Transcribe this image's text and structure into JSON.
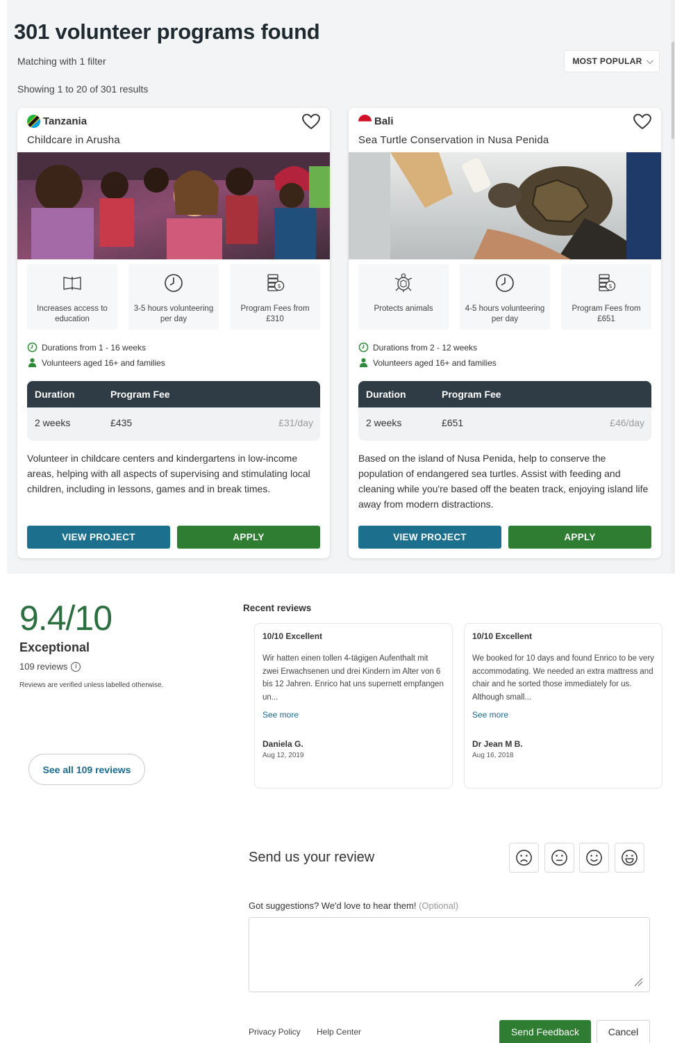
{
  "listing": {
    "title": "301 volunteer programs found",
    "filter_text": "Matching with 1 filter",
    "showing_text": "Showing 1 to 20 of 301 results",
    "sort_label": "MOST POPULAR"
  },
  "table_headers": {
    "duration": "Duration",
    "fee": "Program Fee"
  },
  "buttons": {
    "view": "VIEW PROJECT",
    "apply": "APPLY"
  },
  "programs": [
    {
      "country": "Tanzania",
      "name": "Childcare in Arusha",
      "features": [
        {
          "icon": "book-icon",
          "label": "Increases access to education"
        },
        {
          "icon": "clock-icon",
          "label": "3-5 hours volunteering per day"
        },
        {
          "icon": "money-icon",
          "label": "Program Fees from £310"
        }
      ],
      "durations": "Durations from 1 - 16 weeks",
      "ages": "Volunteers aged 16+ and families",
      "fee_row": {
        "duration": "2 weeks",
        "fee": "£435",
        "per_day": "£31/day"
      },
      "description": "Volunteer in childcare centers and kindergartens in low-income areas, helping with all aspects of supervising and stimulating local children, including in lessons, games and in break times."
    },
    {
      "country": "Bali",
      "name": "Sea Turtle Conservation in Nusa Penida",
      "features": [
        {
          "icon": "turtle-icon",
          "label": "Protects animals"
        },
        {
          "icon": "clock-icon",
          "label": "4-5 hours volunteering per day"
        },
        {
          "icon": "money-icon",
          "label": "Program Fees from £651"
        }
      ],
      "durations": "Durations from 2 - 12 weeks",
      "ages": "Volunteers aged 16+ and families",
      "fee_row": {
        "duration": "2 weeks",
        "fee": "£651",
        "per_day": "£46/day"
      },
      "description": "Based on the island of Nusa Penida, help to conserve the population of endangered sea turtles. Assist with feeding and cleaning while you're based off the beaten track, enjoying island life away from modern distractions."
    }
  ],
  "reviews": {
    "score": "9.4/10",
    "rating_word": "Exceptional",
    "count_text": "109 reviews",
    "verified_note": "Reviews are verified unless labelled otherwise.",
    "see_all": "See all 109 reviews",
    "recent_label": "Recent reviews",
    "see_more": "See more",
    "items": [
      {
        "rating": "10/10 Excellent",
        "text": "Wir hatten einen tollen 4-tägigen Aufenthalt mit zwei Erwachsenen und drei Kindern im Alter von 6 bis 12 Jahren. Enrico hat uns supernett empfangen un...",
        "author": "Daniela G.",
        "date": "Aug 12, 2019"
      },
      {
        "rating": "10/10 Excellent",
        "text": "We booked for 10 days and found Enrico to be very accommodating. We needed an extra mattress and chair and he sorted those immediately for us. Although small...",
        "author": "Dr Jean M B.",
        "date": "Aug 16, 2018"
      }
    ]
  },
  "feedback": {
    "title": "Send us your review",
    "prompt": "Got suggestions? We'd love to hear them!",
    "optional": "(Optional)",
    "textarea_value": "",
    "send": "Send Feedback",
    "cancel": "Cancel",
    "links": [
      "Privacy Policy",
      "Help Center"
    ],
    "emojis": [
      "sad-face-icon",
      "neutral-face-icon",
      "smile-face-icon",
      "happy-face-icon"
    ]
  },
  "colors": {
    "primary_blue": "#1d6f8e",
    "apply_green": "#2e7d32",
    "score_green": "#2b6e3f",
    "table_header": "#2f3c46"
  }
}
